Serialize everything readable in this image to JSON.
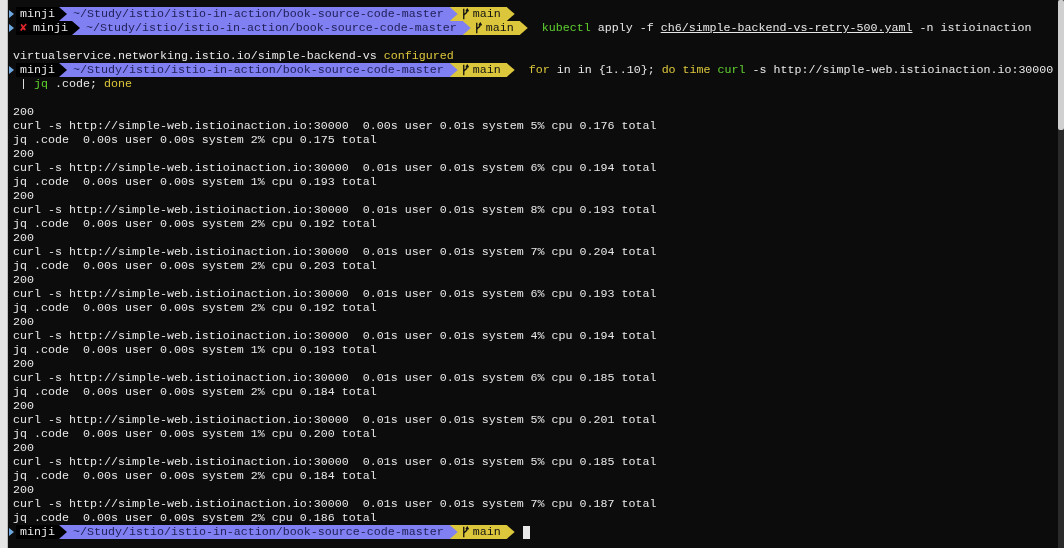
{
  "terminal": {
    "lines": [
      {
        "kind": "prompt",
        "user": "minji",
        "path": "~/Study/istio/istio-in-action/book-source-code-master",
        "branch": "main"
      },
      {
        "kind": "prompt",
        "status": "✘",
        "user": "minji",
        "path": "~/Study/istio/istio-in-action/book-source-code-master",
        "branch": "main",
        "segments": [
          {
            "kind": "command",
            "text": "kubectl"
          },
          {
            "kind": "text",
            "text": " apply -f "
          },
          {
            "kind": "path",
            "text": "ch6/simple-backend-vs-retry-500.yaml"
          },
          {
            "kind": "text",
            "text": " -n istioinaction"
          }
        ]
      },
      {
        "kind": "blank"
      },
      {
        "kind": "output",
        "segments": [
          {
            "kind": "text",
            "text": "virtualservice.networking.istio.io/simple-backend-vs "
          },
          {
            "kind": "keyword",
            "text": "configured"
          }
        ]
      },
      {
        "kind": "prompt",
        "user": "minji",
        "path": "~/Study/istio/istio-in-action/book-source-code-master",
        "branch": "main",
        "segments": [
          {
            "kind": "keyword",
            "text": "for"
          },
          {
            "kind": "text",
            "text": " in in {1..10}; "
          },
          {
            "kind": "keyword",
            "text": "do time "
          },
          {
            "kind": "command",
            "text": "curl"
          },
          {
            "kind": "text",
            "text": " -s http://simple-web.istioinaction.io:30000"
          }
        ]
      },
      {
        "kind": "output",
        "segments": [
          {
            "kind": "text",
            "text": " | "
          },
          {
            "kind": "command",
            "text": "jq"
          },
          {
            "kind": "text",
            "text": " .code; "
          },
          {
            "kind": "keyword",
            "text": "done"
          }
        ]
      },
      {
        "kind": "blank"
      },
      {
        "kind": "output",
        "segments": [
          {
            "kind": "text",
            "text": "200"
          }
        ]
      },
      {
        "kind": "output",
        "segments": [
          {
            "kind": "text",
            "text": "curl -s http://simple-web.istioinaction.io:30000  0.00s user 0.01s system 5% cpu 0.176 total"
          }
        ]
      },
      {
        "kind": "output",
        "segments": [
          {
            "kind": "text",
            "text": "jq .code  0.00s user 0.00s system 2% cpu 0.175 total"
          }
        ]
      },
      {
        "kind": "output",
        "segments": [
          {
            "kind": "text",
            "text": "200"
          }
        ]
      },
      {
        "kind": "output",
        "segments": [
          {
            "kind": "text",
            "text": "curl -s http://simple-web.istioinaction.io:30000  0.01s user 0.01s system 6% cpu 0.194 total"
          }
        ]
      },
      {
        "kind": "output",
        "segments": [
          {
            "kind": "text",
            "text": "jq .code  0.00s user 0.00s system 1% cpu 0.193 total"
          }
        ]
      },
      {
        "kind": "output",
        "segments": [
          {
            "kind": "text",
            "text": "200"
          }
        ]
      },
      {
        "kind": "output",
        "segments": [
          {
            "kind": "text",
            "text": "curl -s http://simple-web.istioinaction.io:30000  0.01s user 0.01s system 8% cpu 0.193 total"
          }
        ]
      },
      {
        "kind": "output",
        "segments": [
          {
            "kind": "text",
            "text": "jq .code  0.00s user 0.00s system 2% cpu 0.192 total"
          }
        ]
      },
      {
        "kind": "output",
        "segments": [
          {
            "kind": "text",
            "text": "200"
          }
        ]
      },
      {
        "kind": "output",
        "segments": [
          {
            "kind": "text",
            "text": "curl -s http://simple-web.istioinaction.io:30000  0.01s user 0.01s system 7% cpu 0.204 total"
          }
        ]
      },
      {
        "kind": "output",
        "segments": [
          {
            "kind": "text",
            "text": "jq .code  0.00s user 0.00s system 2% cpu 0.203 total"
          }
        ]
      },
      {
        "kind": "output",
        "segments": [
          {
            "kind": "text",
            "text": "200"
          }
        ]
      },
      {
        "kind": "output",
        "segments": [
          {
            "kind": "text",
            "text": "curl -s http://simple-web.istioinaction.io:30000  0.01s user 0.01s system 6% cpu 0.193 total"
          }
        ]
      },
      {
        "kind": "output",
        "segments": [
          {
            "kind": "text",
            "text": "jq .code  0.00s user 0.00s system 2% cpu 0.192 total"
          }
        ]
      },
      {
        "kind": "output",
        "segments": [
          {
            "kind": "text",
            "text": "200"
          }
        ]
      },
      {
        "kind": "output",
        "segments": [
          {
            "kind": "text",
            "text": "curl -s http://simple-web.istioinaction.io:30000  0.01s user 0.01s system 4% cpu 0.194 total"
          }
        ]
      },
      {
        "kind": "output",
        "segments": [
          {
            "kind": "text",
            "text": "jq .code  0.00s user 0.00s system 1% cpu 0.193 total"
          }
        ]
      },
      {
        "kind": "output",
        "segments": [
          {
            "kind": "text",
            "text": "200"
          }
        ]
      },
      {
        "kind": "output",
        "segments": [
          {
            "kind": "text",
            "text": "curl -s http://simple-web.istioinaction.io:30000  0.01s user 0.01s system 6% cpu 0.185 total"
          }
        ]
      },
      {
        "kind": "output",
        "segments": [
          {
            "kind": "text",
            "text": "jq .code  0.00s user 0.00s system 2% cpu 0.184 total"
          }
        ]
      },
      {
        "kind": "output",
        "segments": [
          {
            "kind": "text",
            "text": "200"
          }
        ]
      },
      {
        "kind": "output",
        "segments": [
          {
            "kind": "text",
            "text": "curl -s http://simple-web.istioinaction.io:30000  0.01s user 0.01s system 5% cpu 0.201 total"
          }
        ]
      },
      {
        "kind": "output",
        "segments": [
          {
            "kind": "text",
            "text": "jq .code  0.00s user 0.00s system 1% cpu 0.200 total"
          }
        ]
      },
      {
        "kind": "output",
        "segments": [
          {
            "kind": "text",
            "text": "200"
          }
        ]
      },
      {
        "kind": "output",
        "segments": [
          {
            "kind": "text",
            "text": "curl -s http://simple-web.istioinaction.io:30000  0.01s user 0.01s system 5% cpu 0.185 total"
          }
        ]
      },
      {
        "kind": "output",
        "segments": [
          {
            "kind": "text",
            "text": "jq .code  0.00s user 0.00s system 2% cpu 0.184 total"
          }
        ]
      },
      {
        "kind": "output",
        "segments": [
          {
            "kind": "text",
            "text": "200"
          }
        ]
      },
      {
        "kind": "output",
        "segments": [
          {
            "kind": "text",
            "text": "curl -s http://simple-web.istioinaction.io:30000  0.01s user 0.01s system 7% cpu 0.187 total"
          }
        ]
      },
      {
        "kind": "output",
        "segments": [
          {
            "kind": "text",
            "text": "jq .code  0.00s user 0.00s system 2% cpu 0.186 total"
          }
        ]
      },
      {
        "kind": "prompt",
        "user": "minji",
        "path": "~/Study/istio/istio-in-action/book-source-code-master",
        "branch": "main",
        "cursor": true
      }
    ]
  }
}
